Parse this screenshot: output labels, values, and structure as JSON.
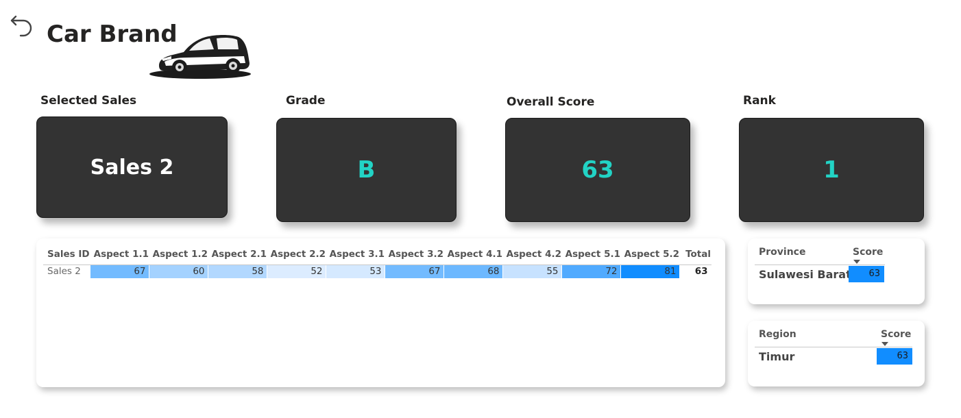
{
  "header": {
    "back_icon": "undo-arrow-icon",
    "title": "Car Brand",
    "logo_icon": "car-silhouette-icon"
  },
  "kpis": {
    "selected_sales": {
      "label": "Selected Sales",
      "value": "Sales 2"
    },
    "grade": {
      "label": "Grade",
      "value": "B"
    },
    "overall_score": {
      "label": "Overall Score",
      "value": "63"
    },
    "rank": {
      "label": "Rank",
      "value": "1"
    }
  },
  "colors": {
    "card_bg": "#333333",
    "kpi_accent": "#22d3c5",
    "heat_max": "#118dff",
    "heat_min": "#dcecff"
  },
  "matrix": {
    "columns": [
      "Sales ID",
      "Aspect 1.1",
      "Aspect 1.2",
      "Aspect 2.1",
      "Aspect 2.2",
      "Aspect 3.1",
      "Aspect 3.2",
      "Aspect 4.1",
      "Aspect 4.2",
      "Aspect 5.1",
      "Aspect 5.2",
      "Total"
    ],
    "rows": [
      {
        "sales_id": "Sales 2",
        "values": [
          "67",
          "60",
          "58",
          "52",
          "53",
          "67",
          "68",
          "55",
          "72",
          "81"
        ],
        "total": "63"
      }
    ]
  },
  "province_table": {
    "columns": [
      "Province",
      "Score"
    ],
    "rows": [
      {
        "name": "Sulawesi Barat",
        "score": "63"
      }
    ]
  },
  "region_table": {
    "columns": [
      "Region",
      "Score"
    ],
    "rows": [
      {
        "name": "Timur",
        "score": "63"
      }
    ]
  }
}
